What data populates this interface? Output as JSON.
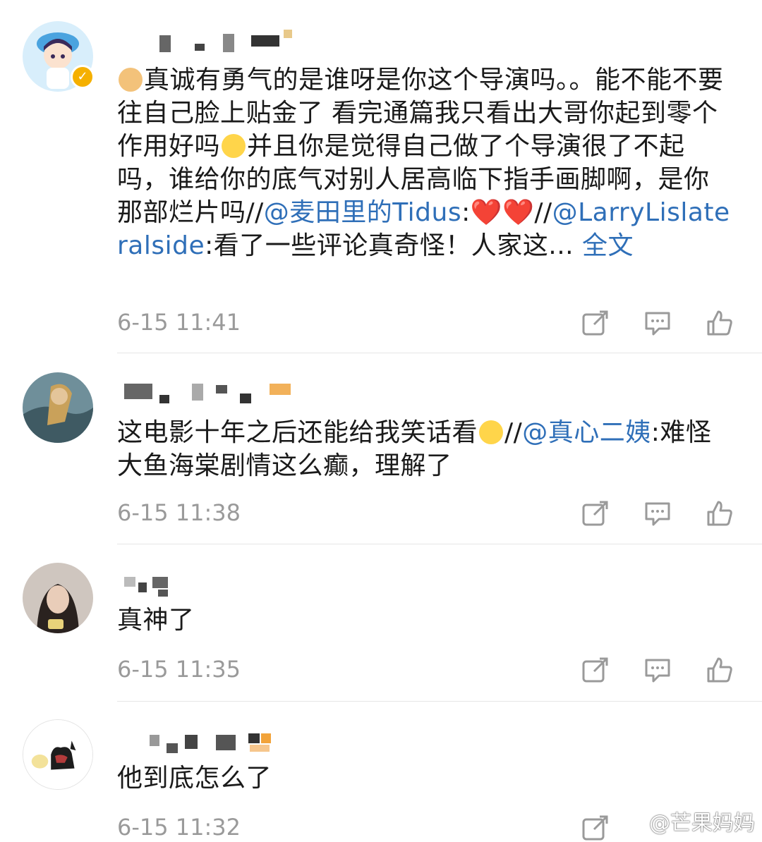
{
  "comments": [
    {
      "text_before_link1": "真诚有勇气的是谁呀是你这个导演吗。。能不能不要往自己脸上贴金了 看完通篇我只看出大哥你起到零个作用好吗",
      "text_after_emoji": "并且你是觉得自己做了个导演很了不起吗，谁给你的底气对别人居高临下指手画脚啊，是你那部烂片吗//",
      "mention1": "@麦田里的Tidus",
      "after_mention1": ":❤️❤️//",
      "mention2": "@LarryLislateralside",
      "after_mention2": ":看了一些评论真奇怪！人家这... ",
      "full_text_link": "全文",
      "time": "6-15 11:41"
    },
    {
      "text_before": "这电影十年之后还能给我笑话看",
      "sep": "//",
      "mention": "@真心二姨",
      "text_after": ":难怪大鱼海棠剧情这么癫，理解了",
      "time": "6-15 11:38"
    },
    {
      "text": "真神了",
      "time": "6-15 11:35"
    },
    {
      "text": "他到底怎么了",
      "time": "6-15 11:32"
    }
  ],
  "watermark": "@芒果妈妈",
  "colors": {
    "link": "#2f6fb8",
    "time": "#9a9a9a",
    "icon": "#9a9a9a",
    "verified": "#f5b000"
  },
  "icons": [
    "share-icon",
    "comment-icon",
    "like-icon"
  ]
}
